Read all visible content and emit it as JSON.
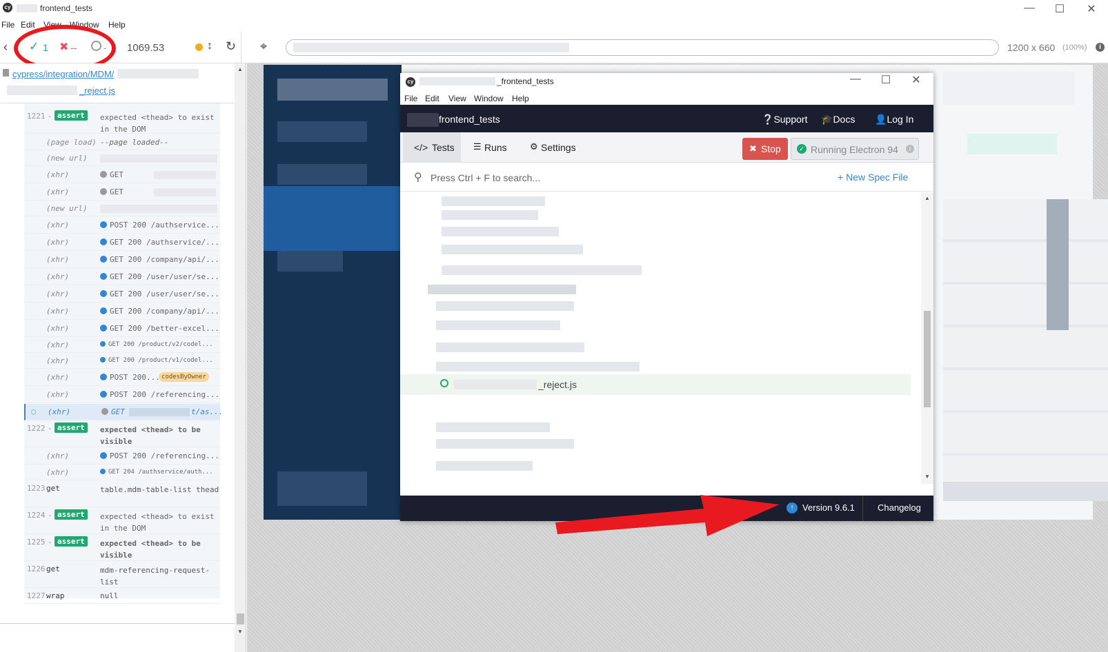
{
  "window": {
    "title": "frontend_tests",
    "menu": [
      "File",
      "Edit",
      "View",
      "Window",
      "Help"
    ]
  },
  "toolbar": {
    "passed": "1",
    "failed": "--",
    "pending": "--",
    "duration": "1069.53",
    "viewport": "1200 x 660",
    "zoom": "(100%)"
  },
  "reporter": {
    "path_prefix": "cypress/integration/MDM/",
    "path_file": "_reject.js",
    "rows": [
      {
        "num": "1221",
        "cmd": "-assert",
        "badge": "assert",
        "msg": "expected <thead> to exist in the DOM"
      },
      {
        "cmd": "(page load)",
        "msg": "--page loaded--"
      },
      {
        "cmd": "(new url)",
        "msg": ""
      },
      {
        "cmd": "(xhr)",
        "msg": "GET"
      },
      {
        "cmd": "(xhr)",
        "msg": "GET"
      },
      {
        "cmd": "(new url)",
        "msg": ""
      },
      {
        "cmd": "(xhr)",
        "msg": "POST 200 /authservice..."
      },
      {
        "cmd": "(xhr)",
        "msg": "GET 200 /authservice/..."
      },
      {
        "cmd": "(xhr)",
        "msg": "GET 200 /company/api/..."
      },
      {
        "cmd": "(xhr)",
        "msg": "GET 200 /user/user/se..."
      },
      {
        "cmd": "(xhr)",
        "msg": "GET 200 /user/user/se..."
      },
      {
        "cmd": "(xhr)",
        "msg": "GET 200 /company/api/..."
      },
      {
        "cmd": "(xhr)",
        "msg": "GET 200 /better-excel..."
      },
      {
        "cmd": "(xhr)",
        "msg": "GET 200 /product/v2/codel..."
      },
      {
        "cmd": "(xhr)",
        "msg": "GET 200 /product/v1/codel..."
      },
      {
        "cmd": "(xhr)",
        "msg": "POST 200...",
        "alias": "codesByOwner"
      },
      {
        "cmd": "(xhr)",
        "msg": "POST 200 /referencing..."
      },
      {
        "cmd": "(xhr)",
        "msg": "GET",
        "msg2": "t/as..."
      },
      {
        "num": "1222",
        "cmd": "-assert",
        "badge": "assert",
        "msg": "expected <thead> to be visible"
      },
      {
        "cmd": "(xhr)",
        "msg": "POST 200 /referencing..."
      },
      {
        "cmd": "(xhr)",
        "msg": "GET 204 /authservice/auth..."
      },
      {
        "num": "1223",
        "cmd": "get",
        "msg": "table.mdm-table-list thead"
      },
      {
        "num": "1224",
        "cmd": "-assert",
        "badge": "assert",
        "msg": "expected <thead> to exist in the DOM"
      },
      {
        "num": "1225",
        "cmd": "-assert",
        "badge": "assert",
        "msg": "expected <thead> to be visible"
      },
      {
        "num": "1226",
        "cmd": "get",
        "msg": "mdm-referencing-request-list"
      },
      {
        "num": "1227",
        "cmd": "wrap",
        "msg": "null"
      }
    ]
  },
  "inner": {
    "title": "_frontend_tests",
    "menu": [
      "File",
      "Edit",
      "View",
      "Window",
      "Help"
    ],
    "project": "frontend_tests",
    "nav": {
      "support": "Support",
      "docs": "Docs",
      "login": "Log In"
    },
    "tabs": [
      "Tests",
      "Runs",
      "Settings"
    ],
    "stop": "Stop",
    "running": "Running Electron 94",
    "search_placeholder": "Press Ctrl + F to search...",
    "new_spec": "New Spec File",
    "active_spec": "_reject.js",
    "version": "Version 9.6.1",
    "changelog": "Changelog"
  },
  "colors": {
    "pass": "#1fa971",
    "fail": "#e94f5f",
    "stop": "#d9534f",
    "nav": "#1b1e2e",
    "link": "#3386d4",
    "annotation": "#e8191f"
  }
}
